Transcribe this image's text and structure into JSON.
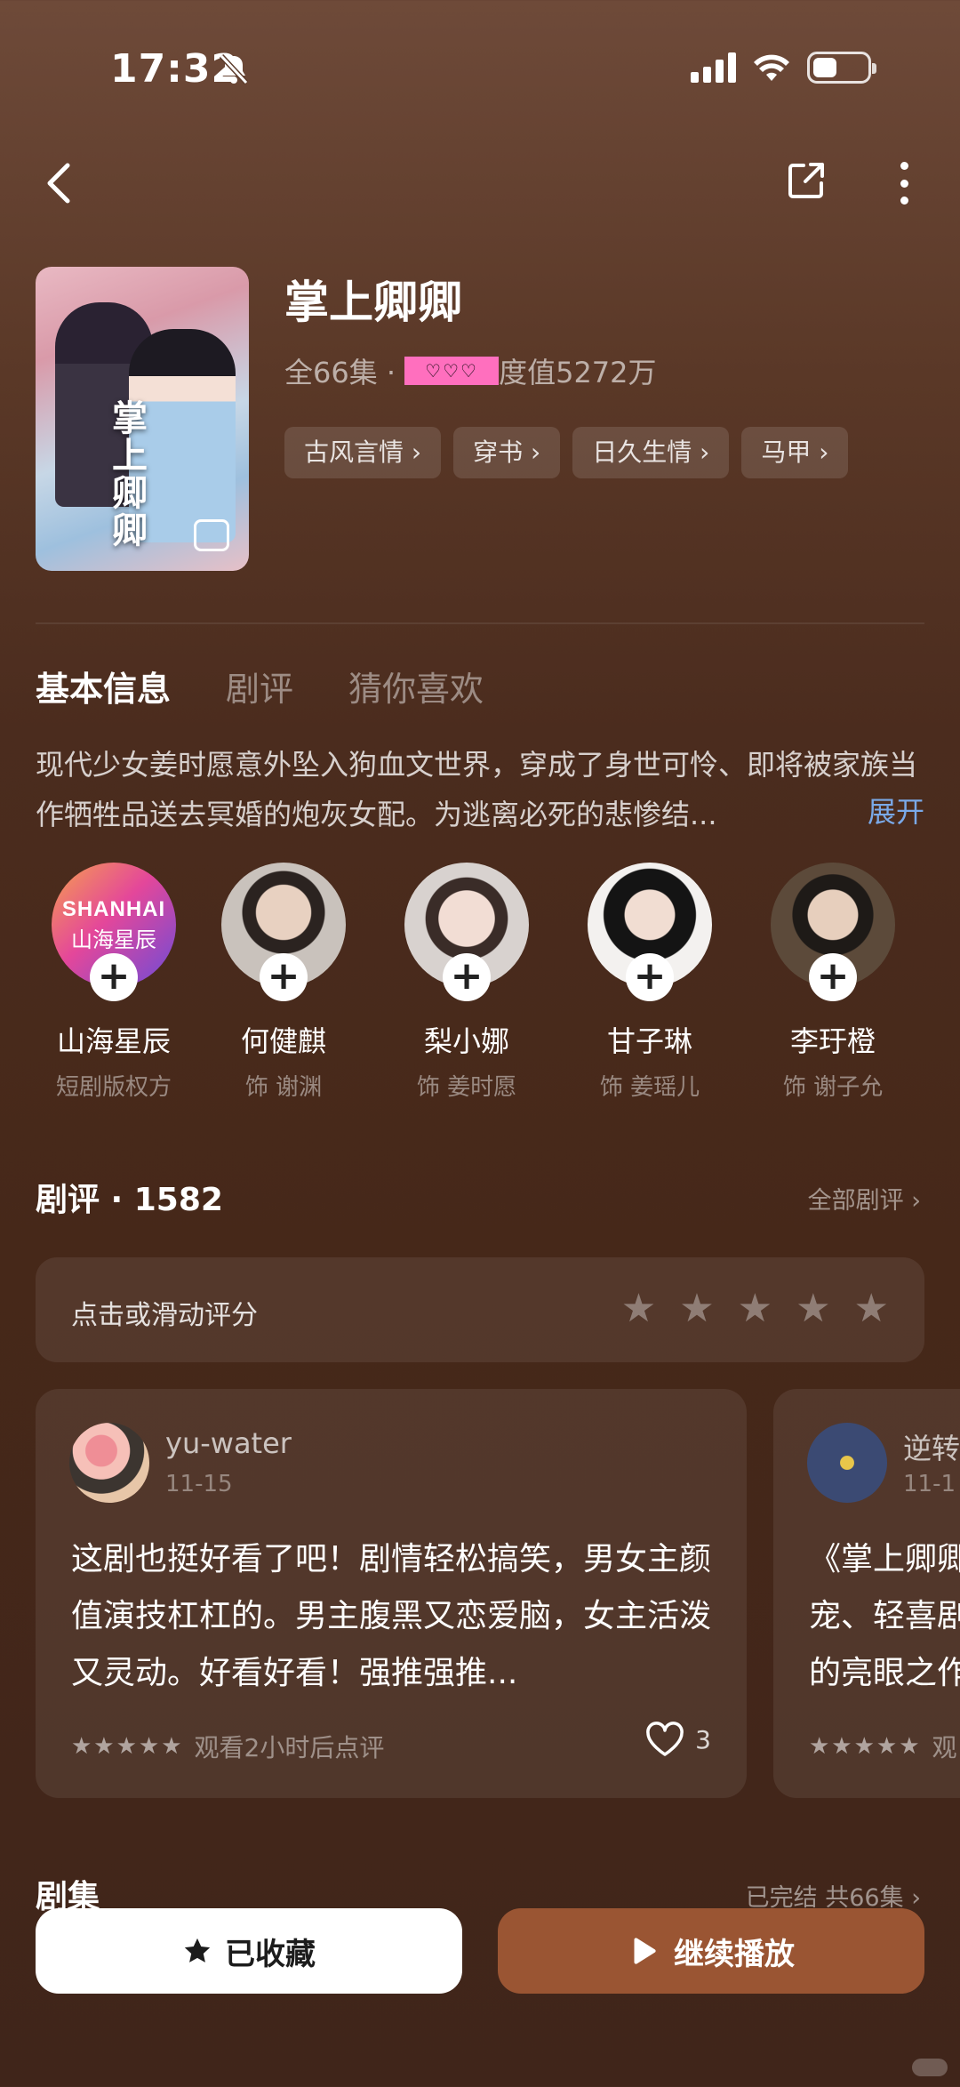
{
  "status_bar": {
    "time": "17:32"
  },
  "drama": {
    "title": "掌上卿卿",
    "episodes_meta": "全66集 ·",
    "heat_suffix": "度值5272万",
    "poster_title": "掌上卿卿",
    "tags": [
      "古风言情 ›",
      "穿书 ›",
      "日久生情 ›",
      "马甲 ›"
    ]
  },
  "tabs": [
    {
      "label": "基本信息",
      "active": true
    },
    {
      "label": "剧评",
      "active": false
    },
    {
      "label": "猜你喜欢",
      "active": false
    }
  ],
  "synopsis": {
    "text": "现代少女姜时愿意外坠入狗血文世界，穿成了身世可怜、即将被家族当作牺牲品送去冥婚的炮灰女配。为逃离必死的悲惨结...",
    "expand_label": "展开"
  },
  "cast": [
    {
      "name": "山海星辰",
      "role": "短剧版权方",
      "logo_text_1": "SHANHAI",
      "logo_text_2": "山海星辰"
    },
    {
      "name": "何健麒",
      "role": "饰 谢渊"
    },
    {
      "name": "梨小娜",
      "role": "饰 姜时愿"
    },
    {
      "name": "甘子琳",
      "role": "饰 姜瑶儿"
    },
    {
      "name": "李玗橙",
      "role": "饰 谢子允"
    }
  ],
  "reviews": {
    "title": "剧评 · 1582",
    "all_label": "全部剧评 ›",
    "rate_prompt": "点击或滑动评分",
    "rating_value": 0,
    "items": [
      {
        "user": "yu-water",
        "date": "11-15",
        "text": "这剧也挺好看了吧！剧情轻松搞笑，男女主颜值演技杠杠的。男主腹黑又恋爱脑，女主活泼又灵动。好看好看！强推强推...",
        "stars": "★★★★★",
        "note": "观看2小时后点评",
        "likes": "3"
      },
      {
        "user": "逆转",
        "date": "11-1",
        "text": "《掌上卿卿宠、轻喜剧的亮眼之作",
        "stars": "★★★★★",
        "note": "观"
      }
    ]
  },
  "episodes": {
    "title": "剧集",
    "status": "已完结 共66集 ›"
  },
  "actions": {
    "favorite_label": "已收藏",
    "play_label": "继续播放"
  },
  "colors": {
    "accent": "#9a5533",
    "link": "#7aa9e8",
    "heat_mask": "#ff6fbe"
  }
}
